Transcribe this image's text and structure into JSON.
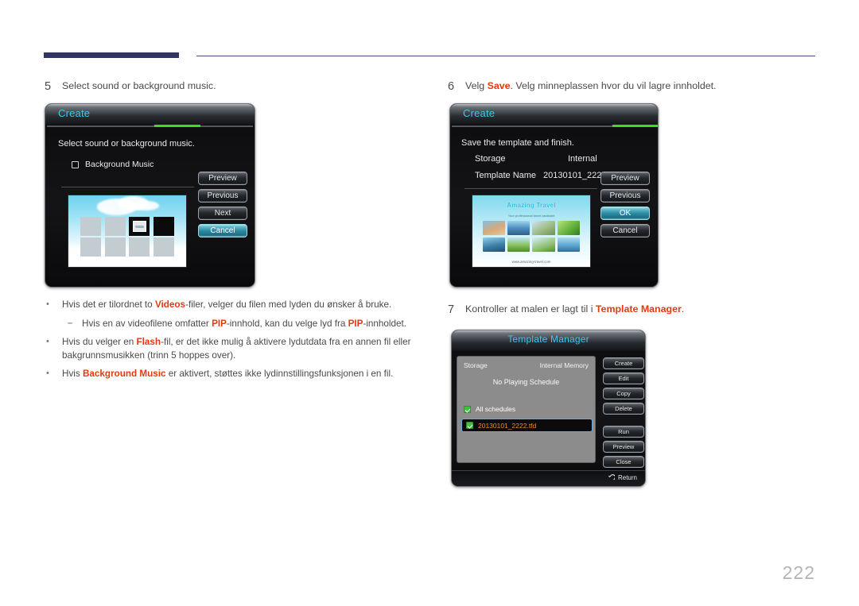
{
  "page": {
    "number": "222"
  },
  "steps": [
    {
      "num": "5",
      "text_parts": [
        {
          "t": "Select sound or background music.",
          "hl": false
        }
      ]
    },
    {
      "num": "6",
      "text_parts": [
        {
          "t": "Velg ",
          "hl": false
        },
        {
          "t": "Save",
          "hl": true
        },
        {
          "t": ". Velg minneplassen hvor du vil lagre innholdet.",
          "hl": false
        }
      ]
    },
    {
      "num": "7",
      "text_parts": [
        {
          "t": "Kontroller at malen er lagt til i ",
          "hl": false
        },
        {
          "t": "Template Manager",
          "hl": true
        },
        {
          "t": ".",
          "hl": false
        }
      ]
    }
  ],
  "step5_label": "5",
  "step5_text": "Select sound or background music.",
  "step6_label": "6",
  "step7_label": "7",
  "bullets": [
    {
      "marker": "•",
      "sub": false,
      "parts": [
        {
          "t": "Hvis det er tilordnet to ",
          "hl": false
        },
        {
          "t": "Videos",
          "hl": true
        },
        {
          "t": "-filer, velger du filen med lyden du ønsker å bruke.",
          "hl": false
        }
      ]
    },
    {
      "marker": "–",
      "sub": true,
      "parts": [
        {
          "t": "Hvis en av videofilene omfatter ",
          "hl": false
        },
        {
          "t": "PIP",
          "hl": true
        },
        {
          "t": "-innhold, kan du velge lyd fra ",
          "hl": false
        },
        {
          "t": "PIP",
          "hl": true
        },
        {
          "t": "-innholdet.",
          "hl": false
        }
      ]
    },
    {
      "marker": "•",
      "sub": false,
      "parts": [
        {
          "t": "Hvis du velger en ",
          "hl": false
        },
        {
          "t": "Flash",
          "hl": true
        },
        {
          "t": "-fil, er det ikke mulig å aktivere lydutdata fra en annen fil eller bakgrunnsmusikken (trinn 5 hoppes over).",
          "hl": false
        }
      ]
    },
    {
      "marker": "•",
      "sub": false,
      "parts": [
        {
          "t": "Hvis ",
          "hl": false
        },
        {
          "t": "Background Music",
          "hl": true
        },
        {
          "t": " er aktivert, støttes ikke lydinnstillingsfunksjonen i en fil.",
          "hl": false
        }
      ]
    }
  ],
  "dialog_create_sound": {
    "title": "Create",
    "progress_percent": 52,
    "instruction": "Select sound or background music.",
    "checkbox": {
      "label": "Background Music",
      "checked": false
    },
    "buttons": [
      {
        "label": "Preview",
        "selected": false
      },
      {
        "label": "Previous",
        "selected": false
      },
      {
        "label": "Next",
        "selected": false
      },
      {
        "label": "Cancel",
        "selected": true
      }
    ]
  },
  "dialog_create_save": {
    "title": "Create",
    "progress_percent": 85,
    "instruction": "Save the template and finish.",
    "fields": [
      {
        "label": "Storage",
        "value": "Internal"
      },
      {
        "label": "Template Name",
        "value": "20130101_2222"
      }
    ],
    "buttons": [
      {
        "label": "Preview",
        "selected": false
      },
      {
        "label": "Previous",
        "selected": false
      },
      {
        "label": "OK",
        "selected": true
      },
      {
        "label": "Cancel",
        "selected": false
      }
    ],
    "preview": {
      "title": "Amazing Travel",
      "subtitle": "Your professional travel assistant",
      "footer": "www.amazing-travel.com"
    }
  },
  "dialog_template_manager": {
    "title": "Template Manager",
    "storage_label": "Storage",
    "storage_value": "Internal Memory",
    "schedule_status": "No Playing Schedule",
    "all_schedules_label": "All schedules",
    "items": [
      {
        "name": "20130101_2222.tfd",
        "checked": true,
        "selected": true
      }
    ],
    "buttons_primary": [
      {
        "label": "Create"
      },
      {
        "label": "Edit"
      },
      {
        "label": "Copy"
      },
      {
        "label": "Delete"
      }
    ],
    "buttons_secondary": [
      {
        "label": "Run"
      },
      {
        "label": "Preview"
      },
      {
        "label": "Close"
      }
    ],
    "return_label": "Return"
  },
  "colors": {
    "accent_red": "#e8380d",
    "osd_title_cyan": "#41c4f0",
    "progress_green": "#3ddd26",
    "selected_button": "#2b8ca4",
    "rule_navy": "#32355e",
    "schedule_item_text": "#f08b20"
  }
}
